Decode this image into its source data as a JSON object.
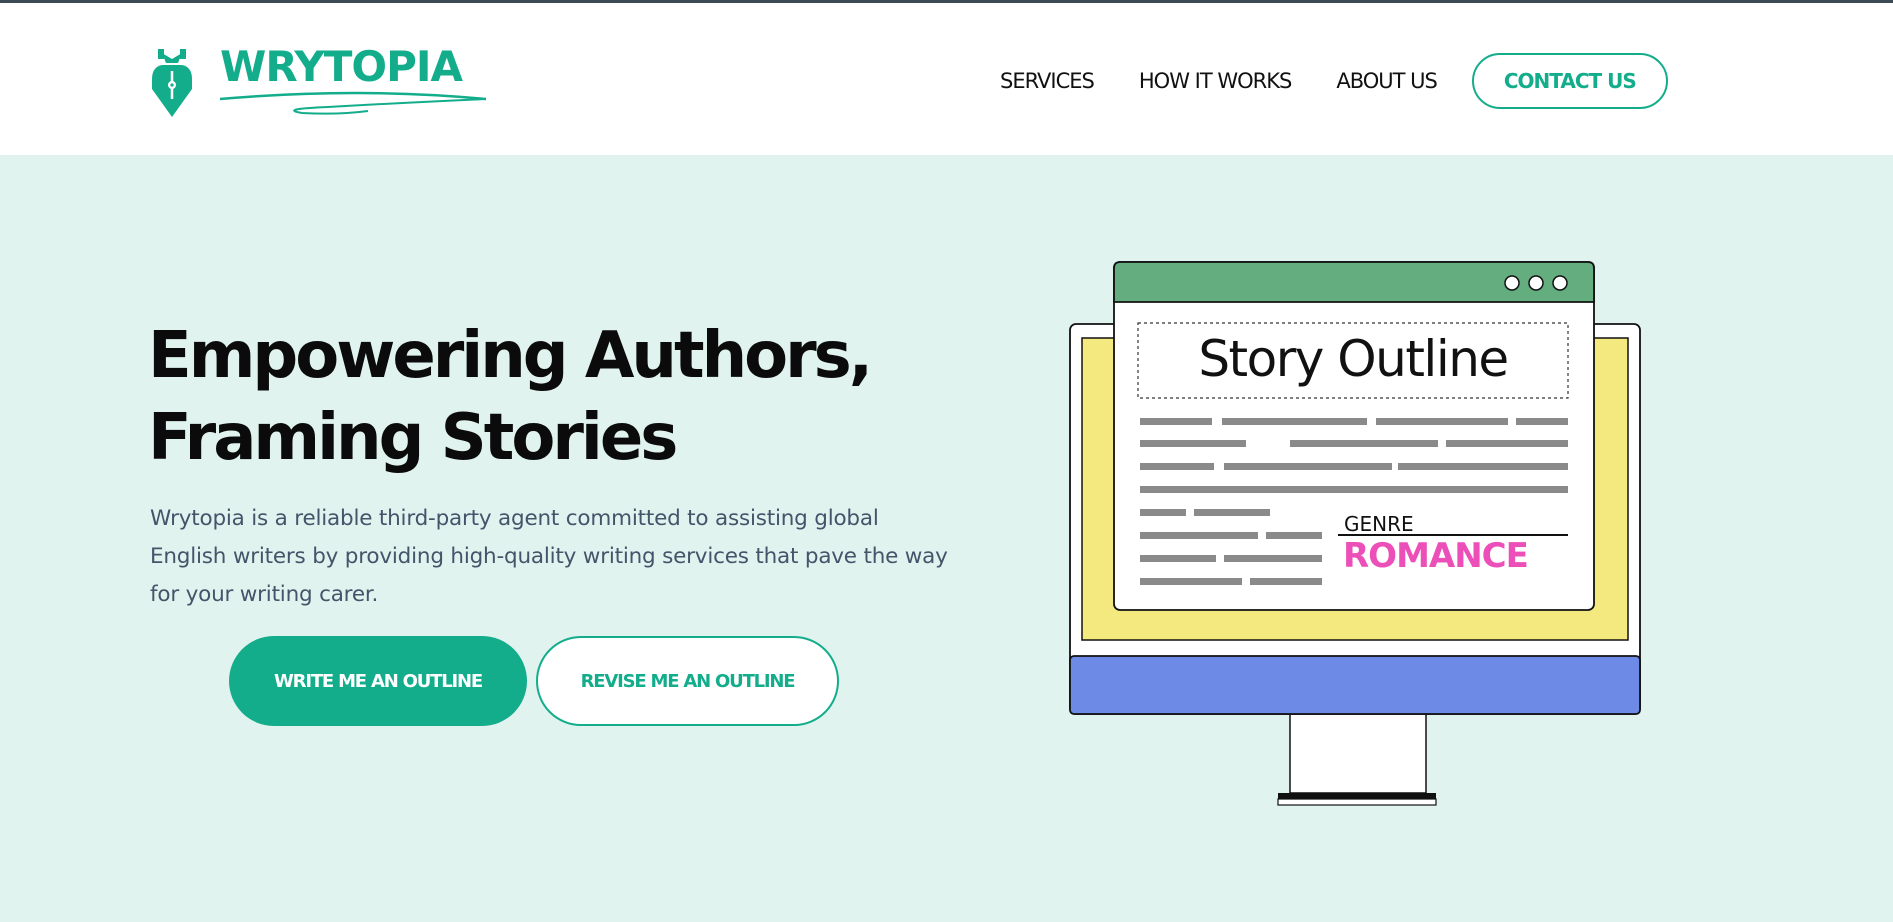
{
  "brand": {
    "name": "WRYTOPIA",
    "accent_color": "#13ad8c"
  },
  "nav": {
    "items": [
      "SERVICES",
      "HOW IT WORKS",
      "ABOUT US"
    ],
    "contact_label": "CONTACT US"
  },
  "hero": {
    "title_line1": "Empowering Authors,",
    "title_line2": "Framing Stories",
    "description": "Wrytopia is a reliable third-party agent committed to assisting global English writers by providing high-quality writing services that pave the way for your writing carer.",
    "primary_button": "WRITE ME AN OUTLINE",
    "secondary_button": "REVISE ME AN OUTLINE"
  },
  "illustration": {
    "doc_title": "Story Outline",
    "genre_label": "GENRE",
    "genre_value": "ROMANCE",
    "colors": {
      "titlebar": "#63ad7f",
      "screen": "#f3e97e",
      "monitor_base": "#6c8ae6",
      "genre": "#ec4fb8"
    }
  }
}
